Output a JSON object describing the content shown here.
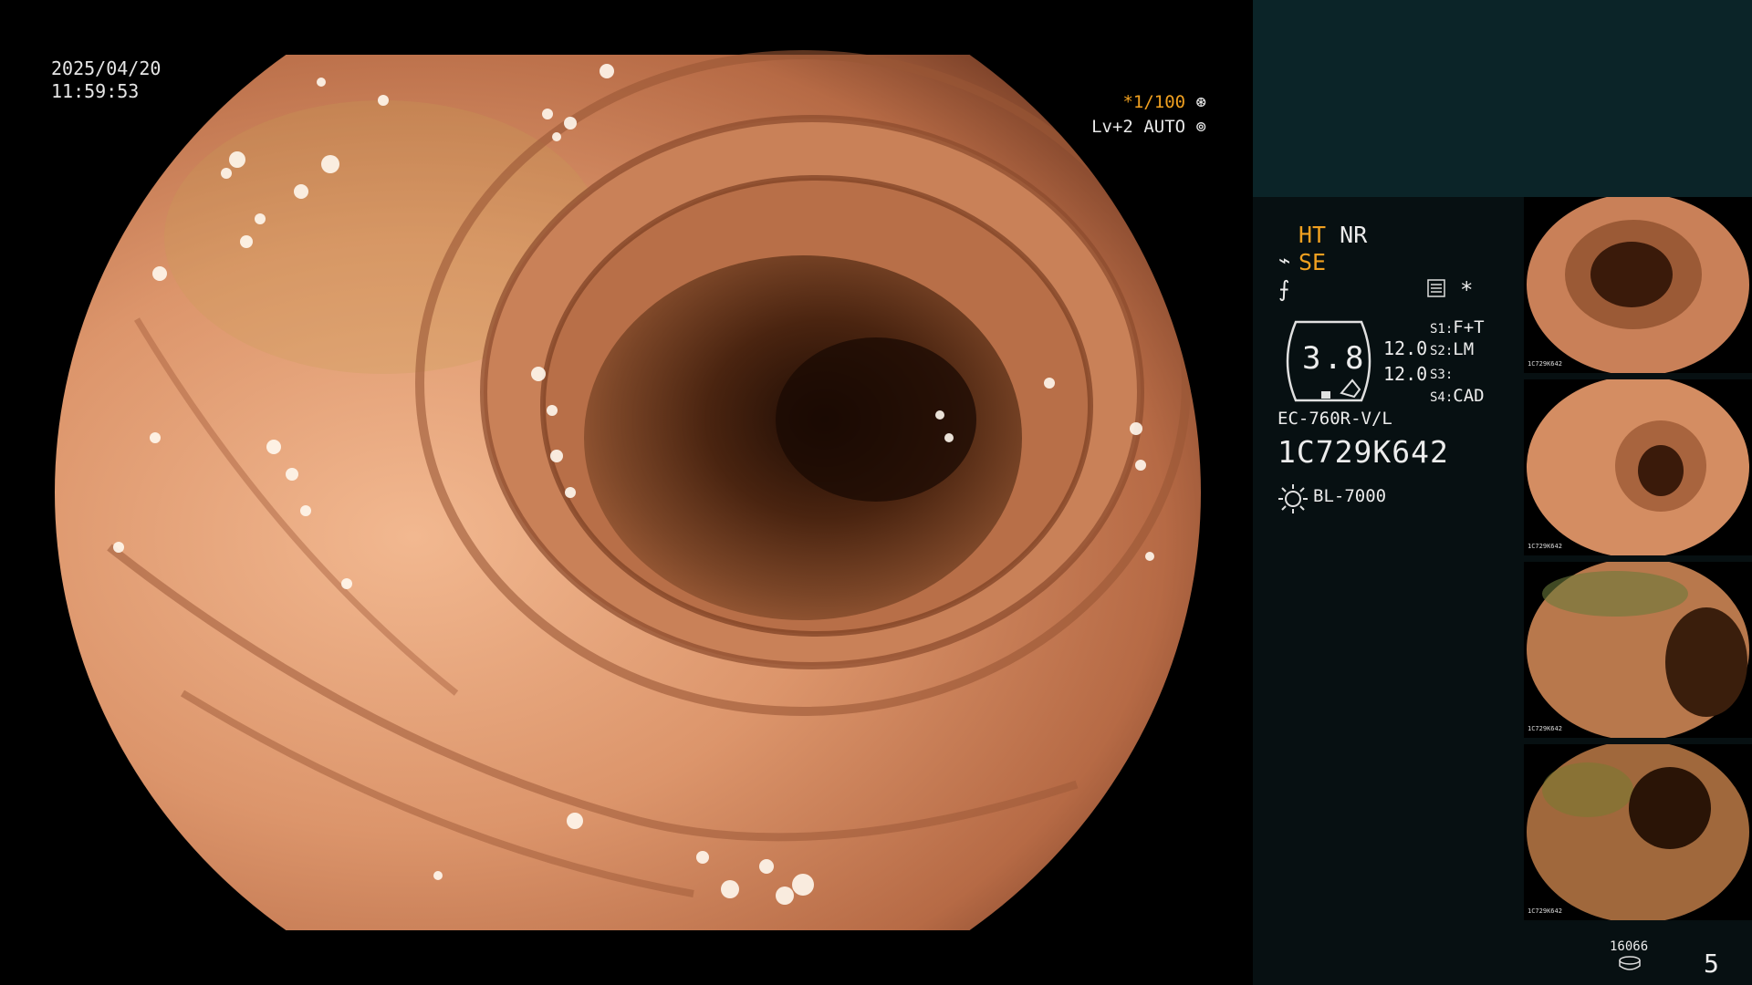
{
  "overlay": {
    "date": "2025/04/20",
    "time": "11:59:53",
    "shutter_speed": "*1/100",
    "level": "Lv+2",
    "exposure_mode": "AUTO"
  },
  "panel": {
    "ht": "HT",
    "nr": "NR",
    "se": "SE",
    "zoom": "3.8",
    "enhancement_1": "12.0",
    "enhancement_2": "12.0",
    "star": "*",
    "slots": [
      {
        "key": "S1",
        "value": "F+T"
      },
      {
        "key": "S2",
        "value": "LM"
      },
      {
        "key": "S3",
        "value": ""
      },
      {
        "key": "S4",
        "value": "CAD"
      }
    ],
    "scope_model": "EC-760R-V/L",
    "serial": "1C729K642",
    "light_source": "BL-7000",
    "memory_count": "16066",
    "page_number": "5",
    "thumbnails": [
      {
        "label": "1C729K642"
      },
      {
        "label": "1C729K642"
      },
      {
        "label": "1C729K642"
      },
      {
        "label": "1C729K642"
      }
    ]
  },
  "colors": {
    "accent_orange": "#f0a020",
    "panel_bg": "#071012",
    "panel_top_bg": "#0b2428",
    "mucosa": "#d08a62"
  },
  "icons": [
    "shutter-icon",
    "auto-exposure-icon",
    "structure-enhance-icon",
    "color-enhance-icon",
    "monitor-icon",
    "light-source-icon",
    "disk-icon"
  ]
}
